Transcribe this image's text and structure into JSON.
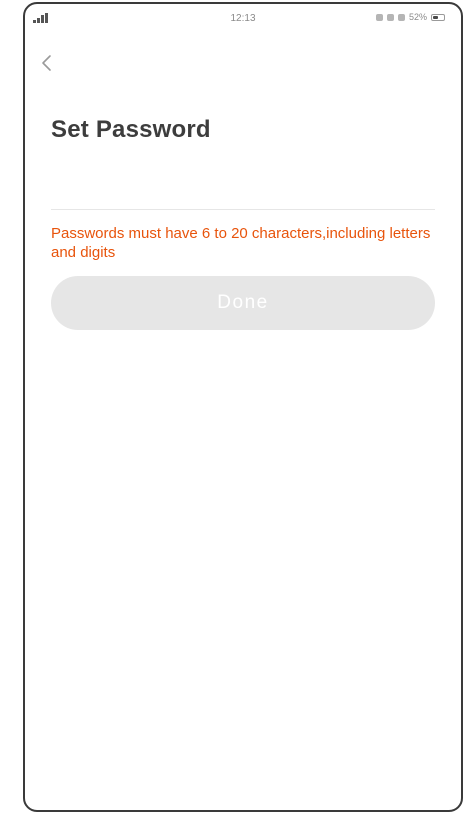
{
  "status_bar": {
    "time": "12:13",
    "battery_text": "52%",
    "battery_level": 0.52
  },
  "nav": {
    "back_icon": "chevron-left-icon"
  },
  "header": {
    "title": "Set Password"
  },
  "form": {
    "password": {
      "value": "",
      "placeholder": ""
    },
    "hint": "Passwords must have 6 to 20 characters,including letters and digits",
    "done_label": "Done"
  },
  "colors": {
    "hint": "#e8540c",
    "button_disabled": "#e6e6e6",
    "title": "#3d3d3d"
  }
}
